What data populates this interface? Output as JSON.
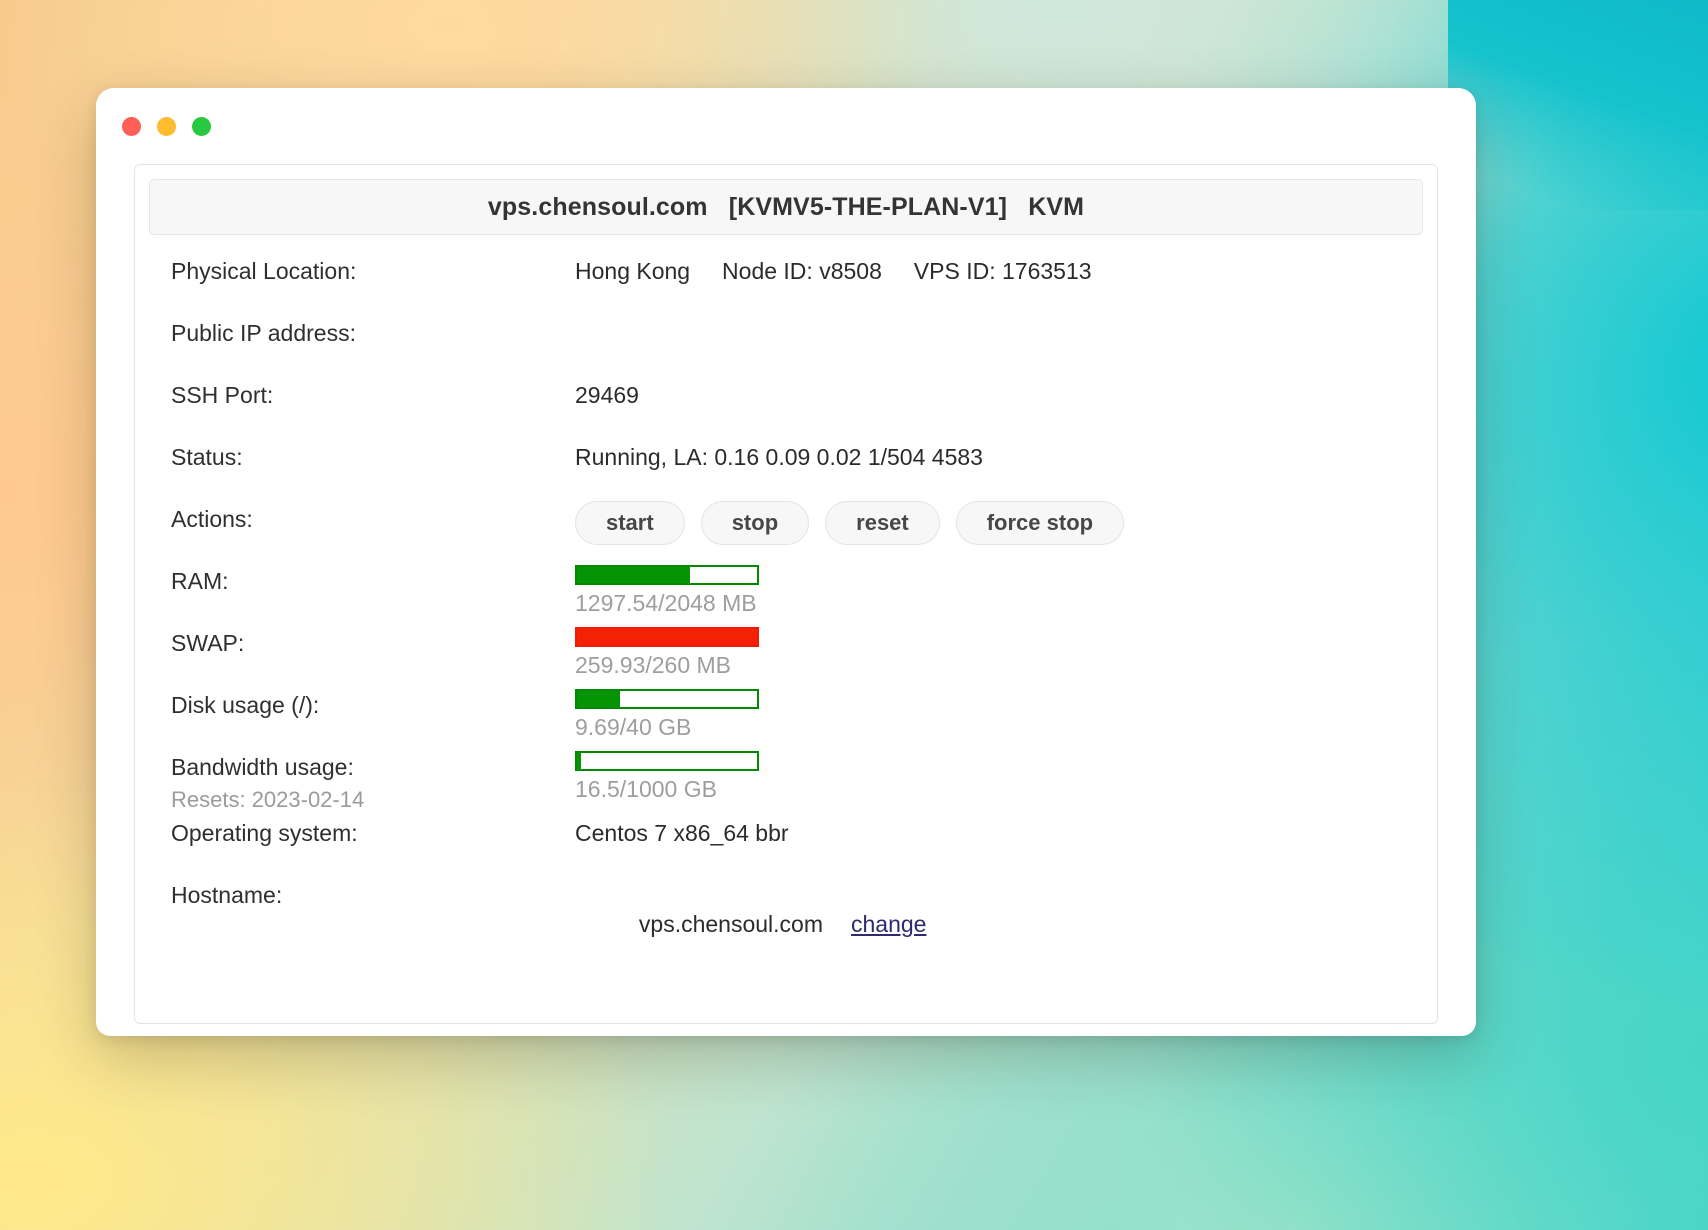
{
  "window": {
    "traffic_lights": [
      "close",
      "minimize",
      "maximize"
    ],
    "colors": {
      "close": "#ff5f57",
      "minimize": "#febc2e",
      "maximize": "#28c840"
    }
  },
  "card": {
    "title": "vps.chensoul.com   [KVMV5-THE-PLAN-V1]   KVM"
  },
  "rows": {
    "physical_location": {
      "label": "Physical Location:",
      "value": "Hong Kong     Node ID: v8508     VPS ID: 1763513"
    },
    "public_ip": {
      "label": "Public IP address:",
      "value": ""
    },
    "ssh_port": {
      "label": "SSH Port:",
      "value": "29469"
    },
    "status": {
      "label": "Status:",
      "value": "Running, LA: 0.16 0.09 0.02 1/504 4583"
    },
    "actions": {
      "label": "Actions:",
      "buttons": [
        {
          "label": "start"
        },
        {
          "label": "stop"
        },
        {
          "label": "reset"
        },
        {
          "label": "force stop"
        }
      ]
    },
    "ram": {
      "label": "RAM:",
      "text": "1297.54/2048 MB",
      "percent": 63,
      "state": "ok"
    },
    "swap": {
      "label": "SWAP:",
      "text": "259.93/260 MB",
      "percent": 100,
      "state": "danger"
    },
    "disk": {
      "label": "Disk usage (/):",
      "text": "9.69/40 GB",
      "percent": 24,
      "state": "ok"
    },
    "bandwidth": {
      "label": "Bandwidth usage:",
      "sub_label": "Resets: 2023-02-14",
      "text": "16.5/1000 GB",
      "percent": 2,
      "state": "ok"
    },
    "operating_system": {
      "label": "Operating system:",
      "value": "Centos 7 x86_64 bbr"
    },
    "hostname": {
      "label": "Hostname:",
      "value": "vps.chensoul.com",
      "change_link": "change"
    }
  },
  "theme": {
    "ok_color": "#049404",
    "danger_color": "#f42105",
    "link_color": "#2b2b6e",
    "muted_color": "#9e9e9e"
  }
}
